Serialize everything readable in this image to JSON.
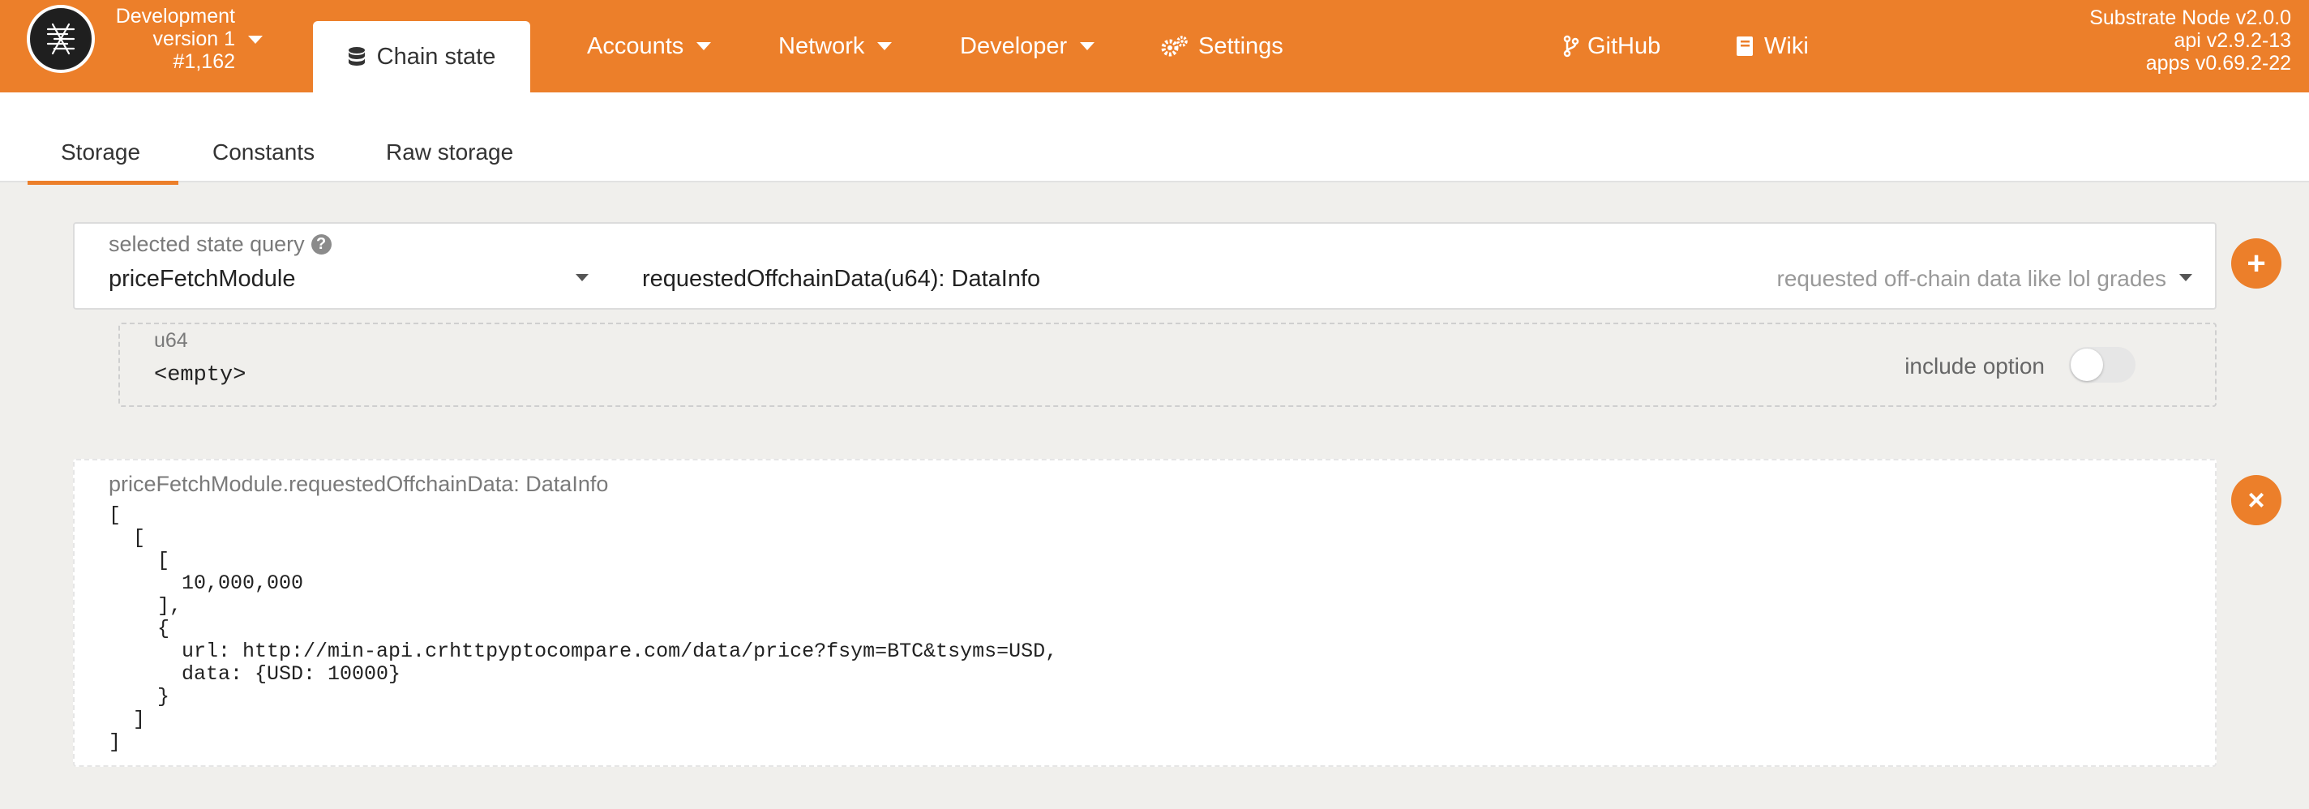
{
  "chain": {
    "name": "Development",
    "version": "version 1",
    "block": "#1,162"
  },
  "nav": {
    "active": "Chain state",
    "items": [
      "Accounts",
      "Network",
      "Developer",
      "Settings"
    ],
    "links": [
      "GitHub",
      "Wiki"
    ]
  },
  "node_info": {
    "node": "Substrate Node v2.0.0",
    "api": "api v2.9.2-13",
    "apps": "apps v0.69.2-22"
  },
  "subtabs": [
    "Storage",
    "Constants",
    "Raw storage"
  ],
  "query": {
    "label": "selected state query",
    "help": "?",
    "module": "priceFetchModule",
    "method": "requestedOffchainData(u64): DataInfo",
    "description": "requested off-chain data like lol grades",
    "add_button": "+"
  },
  "param": {
    "type": "u64",
    "value": "<empty>",
    "toggle_label": "include option",
    "include_option": false
  },
  "result": {
    "title": "priceFetchModule.requestedOffchainData: DataInfo",
    "body": "[\n  [\n    [\n      10,000,000\n    ],\n    {\n      url: http://min-api.crhttpyptocompare.com/data/price?fsym=BTC&tsyms=USD,\n      data: {USD: 10000}\n    }\n  ]\n]",
    "close_button": "×"
  },
  "colors": {
    "accent": "#ec7f2a",
    "background": "#f0efec"
  }
}
